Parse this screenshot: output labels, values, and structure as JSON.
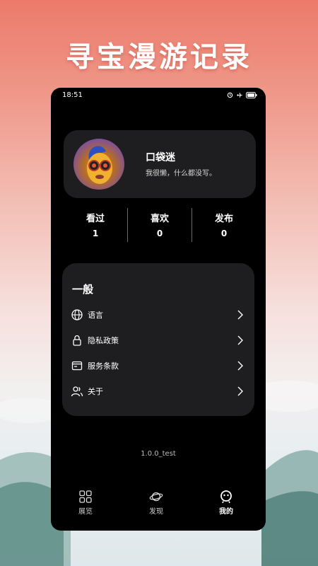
{
  "headline": "寻宝漫游记录",
  "status_bar": {
    "time": "18:51"
  },
  "profile": {
    "name": "口袋迷",
    "bio": "我很懒，什么都没写。"
  },
  "stats": [
    {
      "label": "看过",
      "value": "1"
    },
    {
      "label": "喜欢",
      "value": "0"
    },
    {
      "label": "发布",
      "value": "0"
    }
  ],
  "general": {
    "title": "一般",
    "items": [
      {
        "label": "语言",
        "icon": "globe-icon"
      },
      {
        "label": "隐私政策",
        "icon": "lock-icon"
      },
      {
        "label": "服务条款",
        "icon": "document-icon"
      },
      {
        "label": "关于",
        "icon": "users-icon"
      }
    ]
  },
  "version": "1.0.0_test",
  "tabbar": {
    "tabs": [
      {
        "label": "展览",
        "icon": "grid-icon"
      },
      {
        "label": "发现",
        "icon": "planet-icon"
      },
      {
        "label": "我的",
        "icon": "face-icon",
        "active": true
      }
    ]
  },
  "colors": {
    "card": "#1e1e20",
    "phone_bg": "#000000",
    "headline": "#ffffff"
  }
}
